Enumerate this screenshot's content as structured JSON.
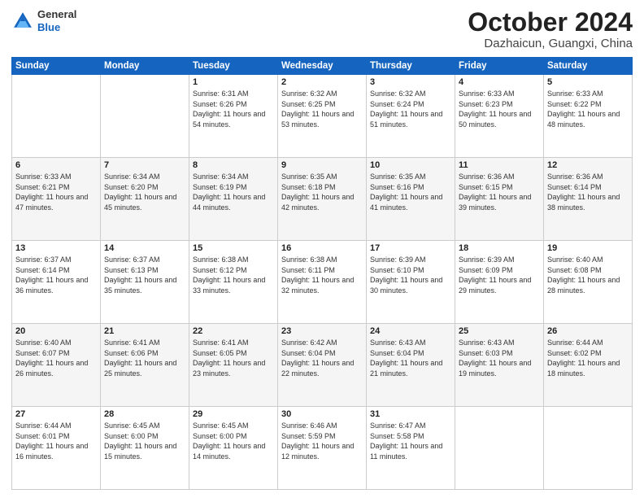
{
  "header": {
    "logo_general": "General",
    "logo_blue": "Blue",
    "month_title": "October 2024",
    "location": "Dazhaicun, Guangxi, China"
  },
  "days_of_week": [
    "Sunday",
    "Monday",
    "Tuesday",
    "Wednesday",
    "Thursday",
    "Friday",
    "Saturday"
  ],
  "weeks": [
    [
      {
        "day": "",
        "detail": ""
      },
      {
        "day": "",
        "detail": ""
      },
      {
        "day": "1",
        "detail": "Sunrise: 6:31 AM\nSunset: 6:26 PM\nDaylight: 11 hours and 54 minutes."
      },
      {
        "day": "2",
        "detail": "Sunrise: 6:32 AM\nSunset: 6:25 PM\nDaylight: 11 hours and 53 minutes."
      },
      {
        "day": "3",
        "detail": "Sunrise: 6:32 AM\nSunset: 6:24 PM\nDaylight: 11 hours and 51 minutes."
      },
      {
        "day": "4",
        "detail": "Sunrise: 6:33 AM\nSunset: 6:23 PM\nDaylight: 11 hours and 50 minutes."
      },
      {
        "day": "5",
        "detail": "Sunrise: 6:33 AM\nSunset: 6:22 PM\nDaylight: 11 hours and 48 minutes."
      }
    ],
    [
      {
        "day": "6",
        "detail": "Sunrise: 6:33 AM\nSunset: 6:21 PM\nDaylight: 11 hours and 47 minutes."
      },
      {
        "day": "7",
        "detail": "Sunrise: 6:34 AM\nSunset: 6:20 PM\nDaylight: 11 hours and 45 minutes."
      },
      {
        "day": "8",
        "detail": "Sunrise: 6:34 AM\nSunset: 6:19 PM\nDaylight: 11 hours and 44 minutes."
      },
      {
        "day": "9",
        "detail": "Sunrise: 6:35 AM\nSunset: 6:18 PM\nDaylight: 11 hours and 42 minutes."
      },
      {
        "day": "10",
        "detail": "Sunrise: 6:35 AM\nSunset: 6:16 PM\nDaylight: 11 hours and 41 minutes."
      },
      {
        "day": "11",
        "detail": "Sunrise: 6:36 AM\nSunset: 6:15 PM\nDaylight: 11 hours and 39 minutes."
      },
      {
        "day": "12",
        "detail": "Sunrise: 6:36 AM\nSunset: 6:14 PM\nDaylight: 11 hours and 38 minutes."
      }
    ],
    [
      {
        "day": "13",
        "detail": "Sunrise: 6:37 AM\nSunset: 6:14 PM\nDaylight: 11 hours and 36 minutes."
      },
      {
        "day": "14",
        "detail": "Sunrise: 6:37 AM\nSunset: 6:13 PM\nDaylight: 11 hours and 35 minutes."
      },
      {
        "day": "15",
        "detail": "Sunrise: 6:38 AM\nSunset: 6:12 PM\nDaylight: 11 hours and 33 minutes."
      },
      {
        "day": "16",
        "detail": "Sunrise: 6:38 AM\nSunset: 6:11 PM\nDaylight: 11 hours and 32 minutes."
      },
      {
        "day": "17",
        "detail": "Sunrise: 6:39 AM\nSunset: 6:10 PM\nDaylight: 11 hours and 30 minutes."
      },
      {
        "day": "18",
        "detail": "Sunrise: 6:39 AM\nSunset: 6:09 PM\nDaylight: 11 hours and 29 minutes."
      },
      {
        "day": "19",
        "detail": "Sunrise: 6:40 AM\nSunset: 6:08 PM\nDaylight: 11 hours and 28 minutes."
      }
    ],
    [
      {
        "day": "20",
        "detail": "Sunrise: 6:40 AM\nSunset: 6:07 PM\nDaylight: 11 hours and 26 minutes."
      },
      {
        "day": "21",
        "detail": "Sunrise: 6:41 AM\nSunset: 6:06 PM\nDaylight: 11 hours and 25 minutes."
      },
      {
        "day": "22",
        "detail": "Sunrise: 6:41 AM\nSunset: 6:05 PM\nDaylight: 11 hours and 23 minutes."
      },
      {
        "day": "23",
        "detail": "Sunrise: 6:42 AM\nSunset: 6:04 PM\nDaylight: 11 hours and 22 minutes."
      },
      {
        "day": "24",
        "detail": "Sunrise: 6:43 AM\nSunset: 6:04 PM\nDaylight: 11 hours and 21 minutes."
      },
      {
        "day": "25",
        "detail": "Sunrise: 6:43 AM\nSunset: 6:03 PM\nDaylight: 11 hours and 19 minutes."
      },
      {
        "day": "26",
        "detail": "Sunrise: 6:44 AM\nSunset: 6:02 PM\nDaylight: 11 hours and 18 minutes."
      }
    ],
    [
      {
        "day": "27",
        "detail": "Sunrise: 6:44 AM\nSunset: 6:01 PM\nDaylight: 11 hours and 16 minutes."
      },
      {
        "day": "28",
        "detail": "Sunrise: 6:45 AM\nSunset: 6:00 PM\nDaylight: 11 hours and 15 minutes."
      },
      {
        "day": "29",
        "detail": "Sunrise: 6:45 AM\nSunset: 6:00 PM\nDaylight: 11 hours and 14 minutes."
      },
      {
        "day": "30",
        "detail": "Sunrise: 6:46 AM\nSunset: 5:59 PM\nDaylight: 11 hours and 12 minutes."
      },
      {
        "day": "31",
        "detail": "Sunrise: 6:47 AM\nSunset: 5:58 PM\nDaylight: 11 hours and 11 minutes."
      },
      {
        "day": "",
        "detail": ""
      },
      {
        "day": "",
        "detail": ""
      }
    ]
  ]
}
